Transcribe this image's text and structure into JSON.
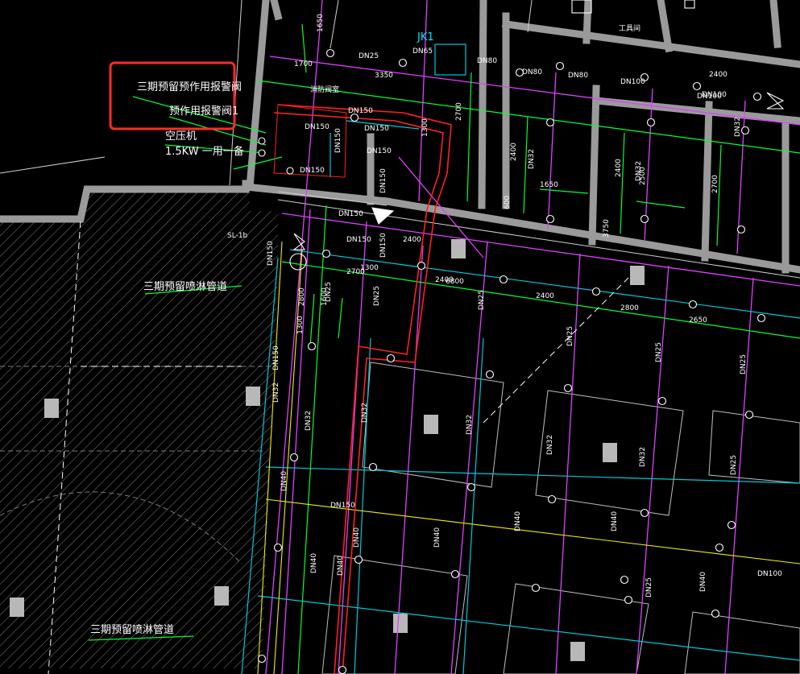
{
  "labels": {
    "highlight_line1": "三期预留预作用报警阀",
    "highlight_line2": "预作用报警阀1",
    "compressor": "空压机",
    "compressor_spec": "1.5KW 一用一备",
    "phase3_sprinkler_1": "三期预留喷淋管道",
    "phase3_sprinkler_2": "三期预留喷淋管道",
    "jk1": "JK1",
    "room1": "消防阀室",
    "room2": "工具间",
    "sl_tag": "SL-1b"
  },
  "pipe_sizes": [
    "DN25",
    "DN65",
    "DN80",
    "DN80",
    "DN80",
    "DN100",
    "DN100",
    "DN150",
    "DN150",
    "DN150",
    "DN150",
    "DN150",
    "DN150",
    "DN150",
    "DN150",
    "DN150",
    "DN150",
    "DN150",
    "DN150",
    "DN32",
    "DN32",
    "DN32",
    "DN32",
    "DN32",
    "DN32",
    "DN32",
    "DN32",
    "DN32",
    "DN40",
    "DN40",
    "DN40",
    "DN40",
    "DN40",
    "DN40",
    "DN40",
    "DN40",
    "DN25",
    "DN25",
    "DN25",
    "DN25",
    "DN25",
    "DN25",
    "DN25",
    "DN25",
    "DN100",
    "DN100",
    "DN150"
  ],
  "dimensions": [
    "1650",
    "1700",
    "3350",
    "1300",
    "2700",
    "2400",
    "2500",
    "1650",
    "2400",
    "2700",
    "2800",
    "2650",
    "2400",
    "2800",
    "1600",
    "1300",
    "2400",
    "2400",
    "2700",
    "2400",
    "1300",
    "6800",
    "600",
    "3750"
  ],
  "colors": {
    "background": "#000000",
    "wall": "#9a9a9a",
    "pipe_magenta": "#e040ff",
    "pipe_green": "#00ff30",
    "pipe_cyan": "#00c8d8",
    "pipe_yellow": "#f0f000",
    "pipe_red": "#ff2020",
    "text": "#ffffff",
    "highlight_box": "#ff2a2a"
  }
}
